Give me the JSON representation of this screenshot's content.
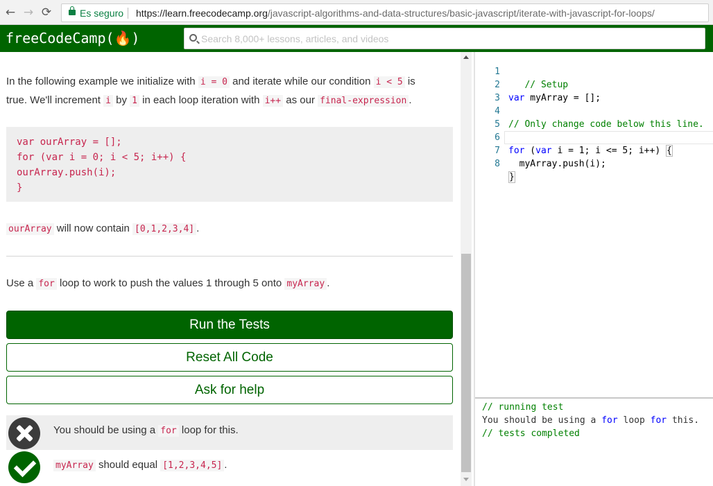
{
  "browser": {
    "secure_label": "Es seguro",
    "url_host": "https://learn.freecodecamp.org",
    "url_path": "/javascript-algorithms-and-data-structures/basic-javascript/iterate-with-javascript-for-loops/"
  },
  "navbar": {
    "logo": "freeCodeCamp(🔥)",
    "search_placeholder": "Search 8,000+ lessons, articles, and videos"
  },
  "lesson": {
    "p1": {
      "t1": "In the following example we initialize with ",
      "c1": "i = 0",
      "t2": " and iterate while our condition ",
      "c2": "i < 5",
      "t3": " is",
      "t4": "true. We'll increment ",
      "c3": "i",
      "t5": " by ",
      "c4": "1",
      "t6": " in each loop iteration with ",
      "c5": "i++",
      "t7": " as our ",
      "c6": "final-expression",
      "t8": "."
    },
    "code_example": [
      "var ourArray = [];",
      "for (var i = 0; i < 5; i++) {",
      "ourArray.push(i);",
      "}"
    ],
    "p2": {
      "c1": "ourArray",
      "t1": " will now contain ",
      "c2": "[0,1,2,3,4]",
      "t2": "."
    },
    "p3": {
      "t1": "Use a ",
      "c1": "for",
      "t2": " loop to work to push the values 1 through 5 onto ",
      "c2": "myArray",
      "t3": "."
    }
  },
  "buttons": {
    "run": "Run the Tests",
    "reset": "Reset All Code",
    "help": "Ask for help"
  },
  "tests": [
    {
      "status": "fail",
      "t1": "You should be using a ",
      "c1": "for",
      "t2": " loop for this."
    },
    {
      "status": "pass",
      "c1": "myArray",
      "t1": " should equal ",
      "c2": "[1,2,3,4,5]",
      "t2": "."
    }
  ],
  "editor": {
    "line_numbers": [
      "1",
      "2",
      "3",
      "4",
      "5",
      "6",
      "7",
      "8"
    ],
    "l1_comment": "   // Setup",
    "l2_kw": "var",
    "l2_rest": " myArray = [];",
    "l4_comment": "// Only change code below this line.",
    "l6_kw1": "for",
    "l6_a": " (",
    "l6_kw2": "var",
    "l6_b": " i = 1; i <= 5; i++) ",
    "l6_brace": "{",
    "l7": "  myArray.push(i);",
    "l8_brace": "}"
  },
  "output": {
    "line1": "// running test",
    "line2_a": "You should be using a ",
    "line2_kw1": "for",
    "line2_b": " loop ",
    "line2_kw2": "for",
    "line2_c": " this.",
    "line3": "// tests completed"
  },
  "colors": {
    "brand_green": "#006400",
    "code_red": "#c7254e",
    "comment_green": "#008000",
    "keyword_blue": "#0000ff"
  }
}
